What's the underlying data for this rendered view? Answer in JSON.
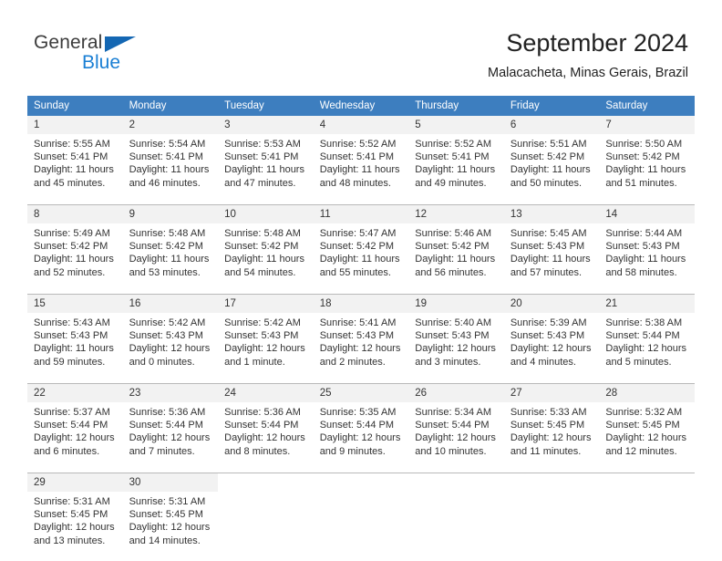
{
  "brand": {
    "line1": "General",
    "line2": "Blue",
    "triangle_color": "#1467b3",
    "line2_color": "#1a7fd4"
  },
  "header": {
    "title": "September 2024",
    "subtitle": "Malacacheta, Minas Gerais, Brazil"
  },
  "theme": {
    "header_bg": "#3d7ebf",
    "header_text": "#ffffff",
    "daynum_bg": "#f2f2f2",
    "cell_bg": "#ffffff",
    "separator": "#b9b9b9",
    "text": "#333333"
  },
  "weekday_headers": [
    "Sunday",
    "Monday",
    "Tuesday",
    "Wednesday",
    "Thursday",
    "Friday",
    "Saturday"
  ],
  "weeks": [
    {
      "days": [
        {
          "num": "1",
          "sunrise": "Sunrise: 5:55 AM",
          "sunset": "Sunset: 5:41 PM",
          "daylight1": "Daylight: 11 hours",
          "daylight2": "and 45 minutes."
        },
        {
          "num": "2",
          "sunrise": "Sunrise: 5:54 AM",
          "sunset": "Sunset: 5:41 PM",
          "daylight1": "Daylight: 11 hours",
          "daylight2": "and 46 minutes."
        },
        {
          "num": "3",
          "sunrise": "Sunrise: 5:53 AM",
          "sunset": "Sunset: 5:41 PM",
          "daylight1": "Daylight: 11 hours",
          "daylight2": "and 47 minutes."
        },
        {
          "num": "4",
          "sunrise": "Sunrise: 5:52 AM",
          "sunset": "Sunset: 5:41 PM",
          "daylight1": "Daylight: 11 hours",
          "daylight2": "and 48 minutes."
        },
        {
          "num": "5",
          "sunrise": "Sunrise: 5:52 AM",
          "sunset": "Sunset: 5:41 PM",
          "daylight1": "Daylight: 11 hours",
          "daylight2": "and 49 minutes."
        },
        {
          "num": "6",
          "sunrise": "Sunrise: 5:51 AM",
          "sunset": "Sunset: 5:42 PM",
          "daylight1": "Daylight: 11 hours",
          "daylight2": "and 50 minutes."
        },
        {
          "num": "7",
          "sunrise": "Sunrise: 5:50 AM",
          "sunset": "Sunset: 5:42 PM",
          "daylight1": "Daylight: 11 hours",
          "daylight2": "and 51 minutes."
        }
      ]
    },
    {
      "days": [
        {
          "num": "8",
          "sunrise": "Sunrise: 5:49 AM",
          "sunset": "Sunset: 5:42 PM",
          "daylight1": "Daylight: 11 hours",
          "daylight2": "and 52 minutes."
        },
        {
          "num": "9",
          "sunrise": "Sunrise: 5:48 AM",
          "sunset": "Sunset: 5:42 PM",
          "daylight1": "Daylight: 11 hours",
          "daylight2": "and 53 minutes."
        },
        {
          "num": "10",
          "sunrise": "Sunrise: 5:48 AM",
          "sunset": "Sunset: 5:42 PM",
          "daylight1": "Daylight: 11 hours",
          "daylight2": "and 54 minutes."
        },
        {
          "num": "11",
          "sunrise": "Sunrise: 5:47 AM",
          "sunset": "Sunset: 5:42 PM",
          "daylight1": "Daylight: 11 hours",
          "daylight2": "and 55 minutes."
        },
        {
          "num": "12",
          "sunrise": "Sunrise: 5:46 AM",
          "sunset": "Sunset: 5:42 PM",
          "daylight1": "Daylight: 11 hours",
          "daylight2": "and 56 minutes."
        },
        {
          "num": "13",
          "sunrise": "Sunrise: 5:45 AM",
          "sunset": "Sunset: 5:43 PM",
          "daylight1": "Daylight: 11 hours",
          "daylight2": "and 57 minutes."
        },
        {
          "num": "14",
          "sunrise": "Sunrise: 5:44 AM",
          "sunset": "Sunset: 5:43 PM",
          "daylight1": "Daylight: 11 hours",
          "daylight2": "and 58 minutes."
        }
      ]
    },
    {
      "days": [
        {
          "num": "15",
          "sunrise": "Sunrise: 5:43 AM",
          "sunset": "Sunset: 5:43 PM",
          "daylight1": "Daylight: 11 hours",
          "daylight2": "and 59 minutes."
        },
        {
          "num": "16",
          "sunrise": "Sunrise: 5:42 AM",
          "sunset": "Sunset: 5:43 PM",
          "daylight1": "Daylight: 12 hours",
          "daylight2": "and 0 minutes."
        },
        {
          "num": "17",
          "sunrise": "Sunrise: 5:42 AM",
          "sunset": "Sunset: 5:43 PM",
          "daylight1": "Daylight: 12 hours",
          "daylight2": "and 1 minute."
        },
        {
          "num": "18",
          "sunrise": "Sunrise: 5:41 AM",
          "sunset": "Sunset: 5:43 PM",
          "daylight1": "Daylight: 12 hours",
          "daylight2": "and 2 minutes."
        },
        {
          "num": "19",
          "sunrise": "Sunrise: 5:40 AM",
          "sunset": "Sunset: 5:43 PM",
          "daylight1": "Daylight: 12 hours",
          "daylight2": "and 3 minutes."
        },
        {
          "num": "20",
          "sunrise": "Sunrise: 5:39 AM",
          "sunset": "Sunset: 5:43 PM",
          "daylight1": "Daylight: 12 hours",
          "daylight2": "and 4 minutes."
        },
        {
          "num": "21",
          "sunrise": "Sunrise: 5:38 AM",
          "sunset": "Sunset: 5:44 PM",
          "daylight1": "Daylight: 12 hours",
          "daylight2": "and 5 minutes."
        }
      ]
    },
    {
      "days": [
        {
          "num": "22",
          "sunrise": "Sunrise: 5:37 AM",
          "sunset": "Sunset: 5:44 PM",
          "daylight1": "Daylight: 12 hours",
          "daylight2": "and 6 minutes."
        },
        {
          "num": "23",
          "sunrise": "Sunrise: 5:36 AM",
          "sunset": "Sunset: 5:44 PM",
          "daylight1": "Daylight: 12 hours",
          "daylight2": "and 7 minutes."
        },
        {
          "num": "24",
          "sunrise": "Sunrise: 5:36 AM",
          "sunset": "Sunset: 5:44 PM",
          "daylight1": "Daylight: 12 hours",
          "daylight2": "and 8 minutes."
        },
        {
          "num": "25",
          "sunrise": "Sunrise: 5:35 AM",
          "sunset": "Sunset: 5:44 PM",
          "daylight1": "Daylight: 12 hours",
          "daylight2": "and 9 minutes."
        },
        {
          "num": "26",
          "sunrise": "Sunrise: 5:34 AM",
          "sunset": "Sunset: 5:44 PM",
          "daylight1": "Daylight: 12 hours",
          "daylight2": "and 10 minutes."
        },
        {
          "num": "27",
          "sunrise": "Sunrise: 5:33 AM",
          "sunset": "Sunset: 5:45 PM",
          "daylight1": "Daylight: 12 hours",
          "daylight2": "and 11 minutes."
        },
        {
          "num": "28",
          "sunrise": "Sunrise: 5:32 AM",
          "sunset": "Sunset: 5:45 PM",
          "daylight1": "Daylight: 12 hours",
          "daylight2": "and 12 minutes."
        }
      ]
    },
    {
      "days": [
        {
          "num": "29",
          "sunrise": "Sunrise: 5:31 AM",
          "sunset": "Sunset: 5:45 PM",
          "daylight1": "Daylight: 12 hours",
          "daylight2": "and 13 minutes."
        },
        {
          "num": "30",
          "sunrise": "Sunrise: 5:31 AM",
          "sunset": "Sunset: 5:45 PM",
          "daylight1": "Daylight: 12 hours",
          "daylight2": "and 14 minutes."
        },
        {
          "num": "",
          "sunrise": "",
          "sunset": "",
          "daylight1": "",
          "daylight2": ""
        },
        {
          "num": "",
          "sunrise": "",
          "sunset": "",
          "daylight1": "",
          "daylight2": ""
        },
        {
          "num": "",
          "sunrise": "",
          "sunset": "",
          "daylight1": "",
          "daylight2": ""
        },
        {
          "num": "",
          "sunrise": "",
          "sunset": "",
          "daylight1": "",
          "daylight2": ""
        },
        {
          "num": "",
          "sunrise": "",
          "sunset": "",
          "daylight1": "",
          "daylight2": ""
        }
      ]
    }
  ]
}
